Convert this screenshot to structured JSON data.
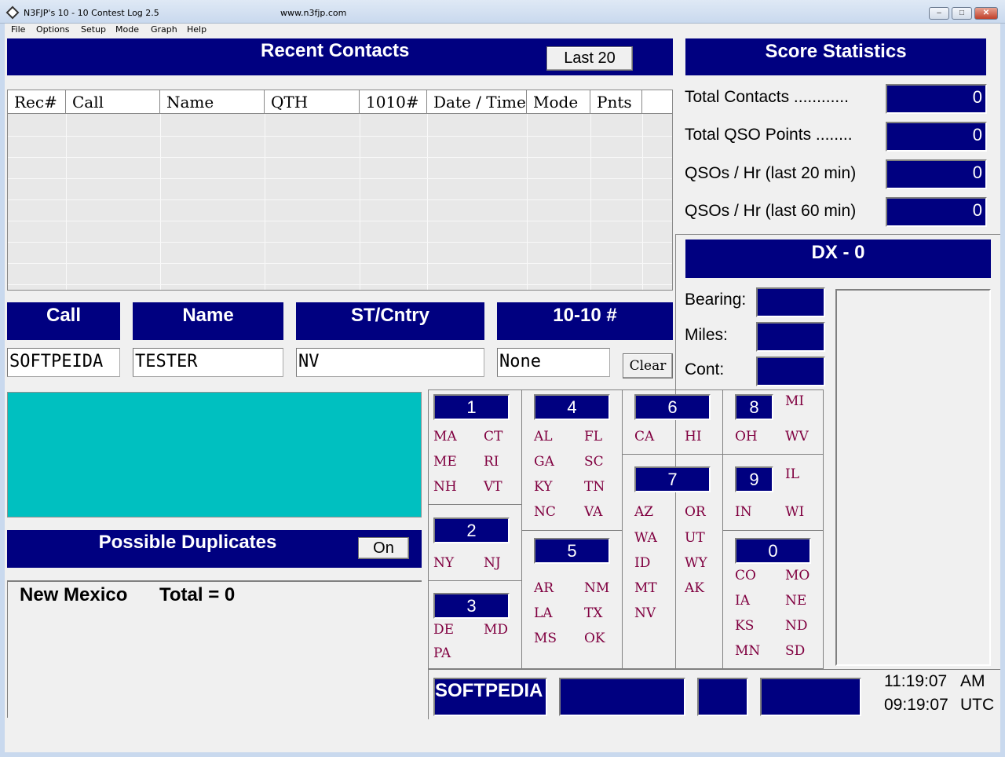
{
  "window": {
    "title": "N3FJP's 10 - 10 Contest Log 2.5",
    "url": "www.n3fjp.com",
    "min_label": "–",
    "max_label": "□",
    "close_label": "✕"
  },
  "menu": [
    "File",
    "Options",
    "Setup",
    "Mode",
    "Graph",
    "Help"
  ],
  "recent": {
    "title": "Recent Contacts",
    "last_button": "Last 20",
    "columns": [
      "Rec#",
      "Call",
      "Name",
      "QTH",
      "1010#",
      "Date / Time",
      "Mode",
      "Pnts"
    ]
  },
  "score": {
    "title": "Score Statistics",
    "rows": [
      {
        "label": "Total Contacts ............",
        "value": "0"
      },
      {
        "label": "Total QSO Points ........",
        "value": "0"
      },
      {
        "label": "QSOs / Hr (last 20 min)",
        "value": "0"
      },
      {
        "label": "QSOs / Hr (last 60 min)",
        "value": "0"
      }
    ]
  },
  "dx": {
    "title": "DX - 0",
    "bearing_label": "Bearing:",
    "miles_label": "Miles:",
    "cont_label": "Cont:"
  },
  "entry": {
    "call_label": "Call",
    "name_label": "Name",
    "st_label": "ST/Cntry",
    "ten_label": "10-10 #",
    "call_value": "SOFTPEIDA",
    "name_value": "TESTER",
    "st_value": "NV",
    "ten_value": "None",
    "clear_button": "Clear"
  },
  "dupes": {
    "title": "Possible Duplicates",
    "toggle": "On",
    "state_text": "New Mexico",
    "total_text": "Total = 0"
  },
  "regions": [
    {
      "num": "1",
      "states": [
        "MA",
        "CT",
        "ME",
        "RI",
        "NH",
        "VT"
      ]
    },
    {
      "num": "2",
      "states": [
        "NY",
        "NJ"
      ]
    },
    {
      "num": "3",
      "states": [
        "DE",
        "MD",
        "PA"
      ]
    },
    {
      "num": "4",
      "states": [
        "AL",
        "FL",
        "GA",
        "SC",
        "KY",
        "TN",
        "NC",
        "VA"
      ]
    },
    {
      "num": "5",
      "states": [
        "AR",
        "NM",
        "LA",
        "TX",
        "MS",
        "OK"
      ]
    },
    {
      "num": "6",
      "states": [
        "CA",
        "HI"
      ]
    },
    {
      "num": "7",
      "states": [
        "AZ",
        "OR",
        "WA",
        "UT",
        "ID",
        "WY",
        "MT",
        "AK",
        "NV"
      ]
    },
    {
      "num": "8",
      "states": [
        "MI",
        "OH",
        "WV"
      ]
    },
    {
      "num": "9",
      "states": [
        "IL",
        "IN",
        "WI"
      ]
    },
    {
      "num": "0",
      "states": [
        "CO",
        "MO",
        "IA",
        "NE",
        "KS",
        "ND",
        "MN",
        "SD"
      ]
    }
  ],
  "bottom": {
    "brand": "SOFTPEDIA",
    "local_time": "11:19:07",
    "local_suffix": "AM",
    "utc_time": "09:19:07",
    "utc_suffix": "UTC"
  },
  "colors": {
    "panel": "#000080",
    "cyan": "#00c0c0",
    "state_text": "#800040"
  }
}
